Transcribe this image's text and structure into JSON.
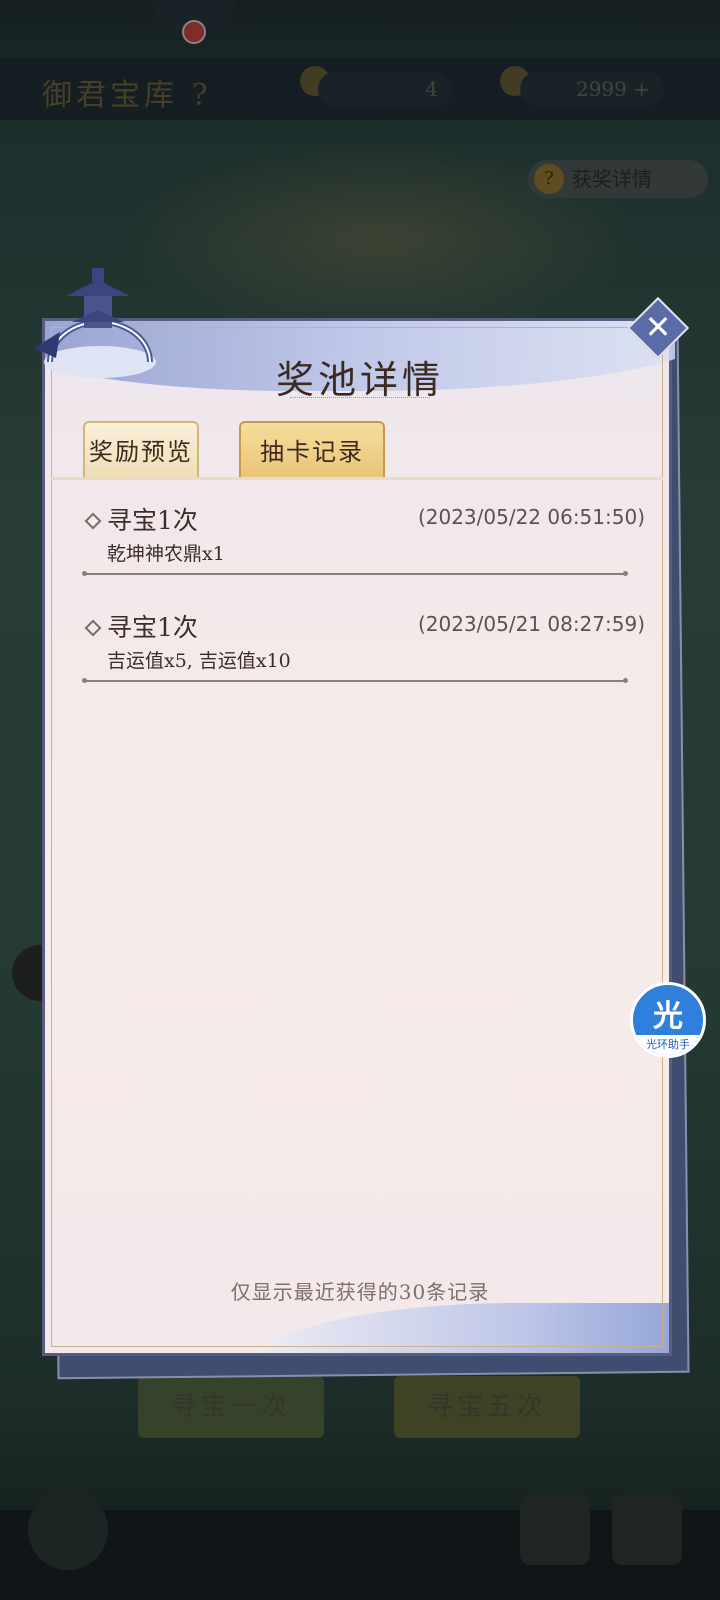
{
  "background": {
    "top_title": "御君宝库 ?",
    "resource_1": "4",
    "resource_2": "2999 +",
    "detail_pill": "获奖详情",
    "draw_once": "寻宝一次",
    "draw_five": "寻宝五次"
  },
  "modal": {
    "title": "奖池详情",
    "close_label": "✕",
    "tabs": [
      {
        "label": "奖励预览",
        "active": false
      },
      {
        "label": "抽卡记录",
        "active": true
      }
    ],
    "records": [
      {
        "title": "寻宝1次",
        "time": "(2023/05/22  06:51:50)",
        "items": "乾坤神农鼎x1"
      },
      {
        "title": "寻宝1次",
        "time": "(2023/05/21  08:27:59)",
        "items": "吉运值x5, 吉运值x10"
      }
    ],
    "footer_note": "仅显示最近获得的30条记录"
  },
  "floating_assistant": {
    "glyph": "光",
    "label": "光环助手"
  },
  "colors": {
    "accent_tab": "#e9c477",
    "modal_border": "#585c80",
    "assistant_blue": "#2f7fdd"
  }
}
